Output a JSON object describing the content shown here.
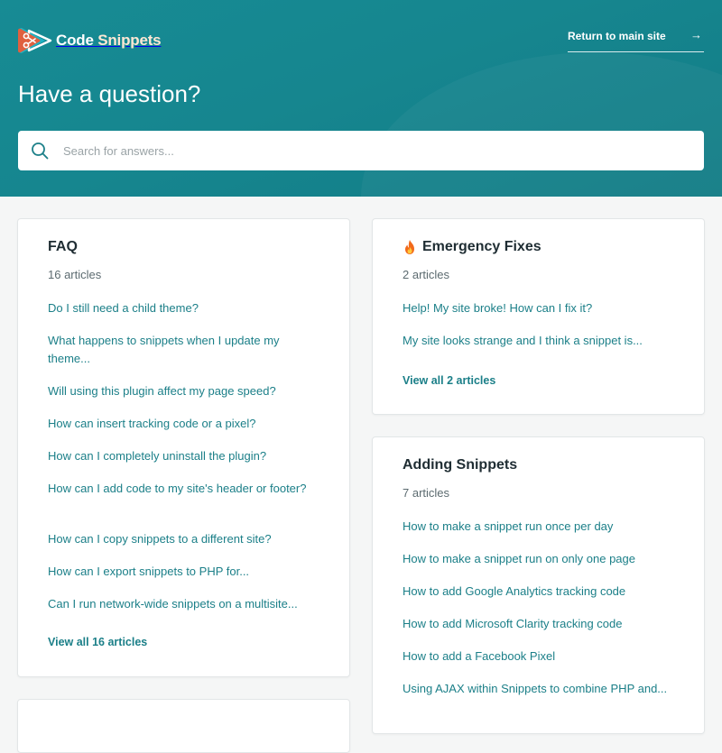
{
  "brand": {
    "name_part1": "Code",
    "name_part2": "Snippets",
    "accent": "#178b94",
    "logo_colors": [
      "#e0603f",
      "#1fb2c4"
    ]
  },
  "header": {
    "return_label": "Return to main site",
    "return_icon": "arrow-right-icon",
    "title": "Have a question?"
  },
  "search": {
    "placeholder": "Search for answers...",
    "value": "",
    "icon": "search-icon"
  },
  "sections": {
    "faq": {
      "title": "FAQ",
      "count": "16 articles",
      "articles": [
        "Do I still need a child theme?",
        "What happens to snippets when I update my theme...",
        "Will using this plugin affect my page speed?",
        "How can insert tracking code or a pixel?",
        "How can I completely uninstall the plugin?",
        "How can I add code to my site's header or footer?",
        "How can I copy snippets to a different site?",
        "How can I export snippets to PHP for...",
        "Can I run network-wide snippets on a multisite..."
      ],
      "view_all": "View all 16 articles"
    },
    "emergency": {
      "title": "Emergency Fixes",
      "icon": "fire-icon",
      "count": "2 articles",
      "articles": [
        "Help! My site broke! How can I fix it?",
        "My site looks strange and I think a snippet is..."
      ],
      "view_all": "View all 2 articles"
    },
    "adding": {
      "title": "Adding Snippets",
      "count": "7 articles",
      "articles": [
        "How to make a snippet run once per day",
        "How to make a snippet run on only one page",
        "How to add Google Analytics tracking code",
        "How to add Microsoft Clarity tracking code",
        "How to add a Facebook Pixel",
        "Using AJAX within Snippets to combine PHP and..."
      ]
    }
  }
}
